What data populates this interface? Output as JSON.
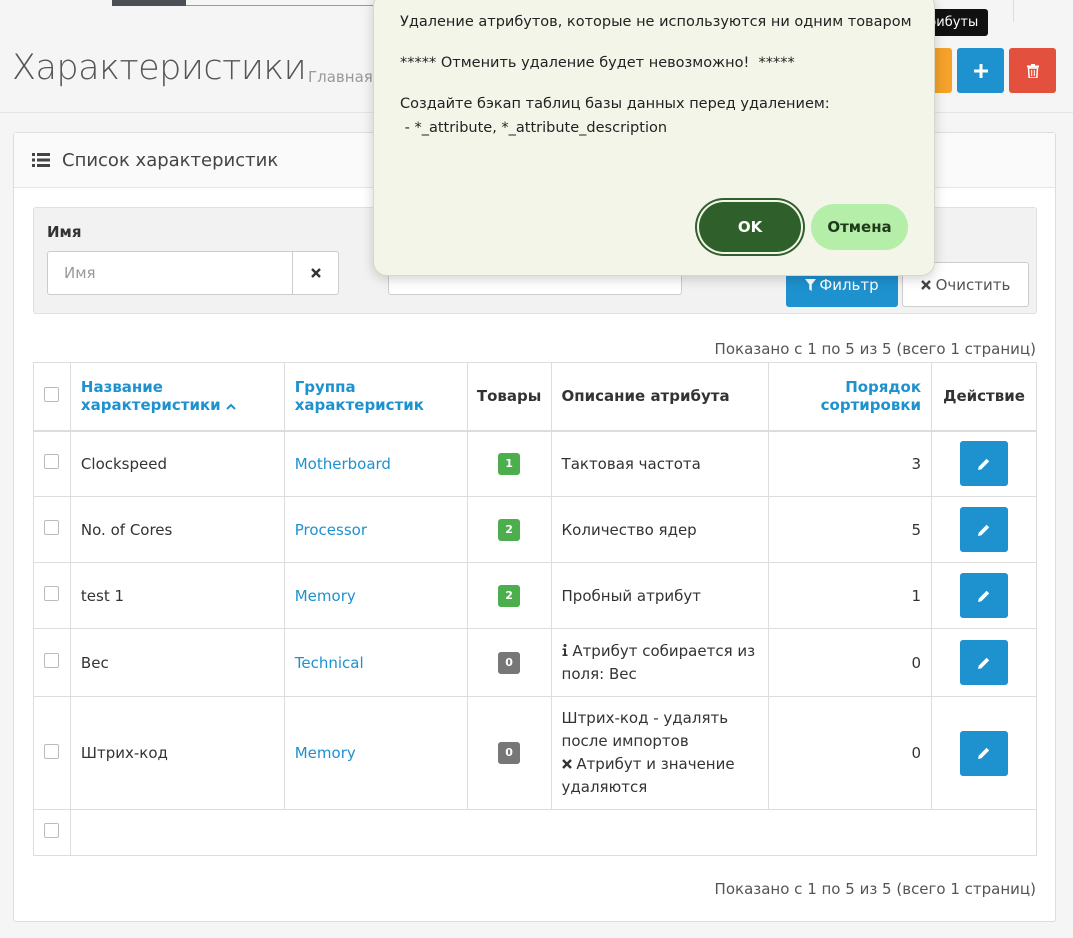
{
  "tooltip": "рибуты",
  "header": {
    "title": "Характеристики",
    "breadcrumb": "Главная"
  },
  "panel": {
    "title": "Список характеристик"
  },
  "filter": {
    "name_label": "Имя",
    "name_placeholder": "Имя",
    "filter_button": "Фильтр",
    "clear_button": "Очистить"
  },
  "results_top": "Показано с 1 по 5 из 5 (всего 1 страниц)",
  "results_bottom": "Показано с 1 по 5 из 5 (всего 1 страниц)",
  "table": {
    "headers": {
      "name_line1": "Название",
      "name_line2": "характеристики",
      "group_line1": "Группа",
      "group_line2": "характеристик",
      "products": "Товары",
      "description": "Описание атрибута",
      "sort_line1": "Порядок",
      "sort_line2": "сортировки",
      "action": "Действие"
    },
    "rows": [
      {
        "name": "Clockspeed",
        "group": "Motherboard",
        "products": "1",
        "desc1": "Тактовая частота",
        "desc2": "",
        "desc3": "",
        "sort": "3"
      },
      {
        "name": "No. of Cores",
        "group": "Processor",
        "products": "2",
        "desc1": "Количество ядер",
        "desc2": "",
        "desc3": "",
        "sort": "5"
      },
      {
        "name": "test 1",
        "group": "Memory",
        "products": "2",
        "desc1": "Пробный атрибут",
        "desc2": "",
        "desc3": "",
        "sort": "1"
      },
      {
        "name": "Вес",
        "group": "Technical",
        "products": "0",
        "desc1": "Атрибут собирается из",
        "desc2": "поля: Вес",
        "desc3": "",
        "sort": "0"
      },
      {
        "name": "Штрих-код",
        "group": "Memory",
        "products": "0",
        "desc1": "Штрих-код - удалять",
        "desc2": "после импортов",
        "desc3": "Атрибут и значение",
        "desc4": "удаляются",
        "sort": "0"
      }
    ]
  },
  "modal": {
    "line1": "Удаление атрибутов, которые не используются ни одним товаром",
    "line2": "***** Отменить удаление будет невозможно!  *****",
    "line3": "Создайте бэкап таблиц базы данных перед удалением:",
    "line4": " - *_attribute, *_attribute_description",
    "ok": "OK",
    "cancel": "Отмена"
  },
  "colors": {
    "primary": "#1e91cf",
    "danger": "#e3503e",
    "warning": "#f4a22a",
    "success_badge": "#4cae4c",
    "ok_button": "#2f5f2b",
    "cancel_button": "#b4eea8"
  },
  "icons": [
    "list-icon",
    "plus-icon",
    "trash-icon",
    "times-icon",
    "filter-icon",
    "pencil-icon",
    "info-icon",
    "sort-up-icon"
  ]
}
